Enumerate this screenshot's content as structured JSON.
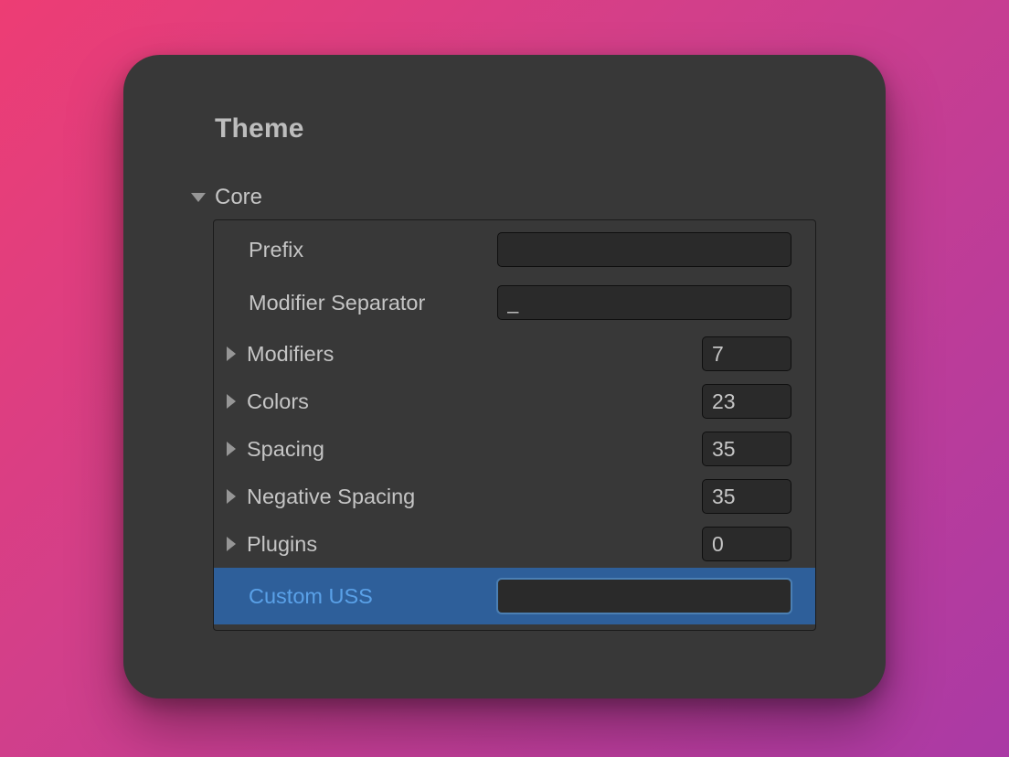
{
  "title": "Theme",
  "section": {
    "label": "Core",
    "fields": {
      "prefix": {
        "label": "Prefix",
        "value": ""
      },
      "modsep": {
        "label": "Modifier Separator",
        "value": "_"
      }
    },
    "foldouts": [
      {
        "label": "Modifiers",
        "count": "7"
      },
      {
        "label": "Colors",
        "count": "23"
      },
      {
        "label": "Spacing",
        "count": "35"
      },
      {
        "label": "Negative Spacing",
        "count": "35"
      },
      {
        "label": "Plugins",
        "count": "0"
      }
    ],
    "custom_uss": {
      "label": "Custom USS",
      "value": ""
    }
  }
}
